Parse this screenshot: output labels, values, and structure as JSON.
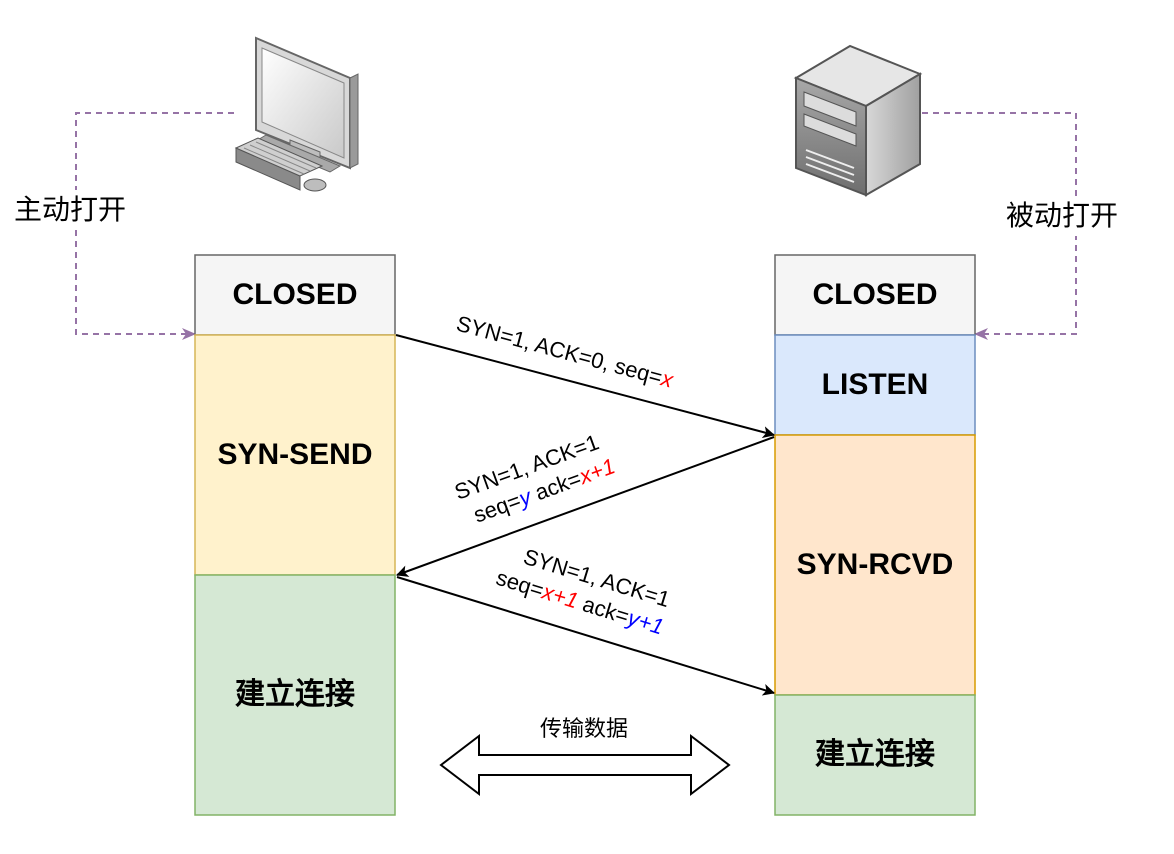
{
  "client": {
    "open_label": "主动打开",
    "states": [
      "CLOSED",
      "SYN-SEND",
      "建立连接"
    ]
  },
  "server": {
    "open_label": "被动打开",
    "states": [
      "CLOSED",
      "LISTEN",
      "SYN-RCVD",
      "建立连接"
    ]
  },
  "messages": {
    "m1": {
      "text": "SYN=1, ACK=0, seq=",
      "var": "x"
    },
    "m2": {
      "line1": "SYN=1, ACK=1",
      "seq_label": "seq=",
      "seq_var": "y",
      "ack_label": " ack=",
      "ack_var": "x+1"
    },
    "m3": {
      "line1": "SYN=1, ACK=1",
      "seq_label": "seq=",
      "seq_var": "x+1",
      "ack_label": " ack=",
      "ack_var": "y+1"
    }
  },
  "data_transfer_label": "传输数据",
  "colors": {
    "closed": "#f5f5f5",
    "syn_send": "#fff2cc",
    "established": "#d5e8d4",
    "listen": "#dae8fc",
    "syn_rcvd": "#ffe6cc",
    "dashed_line": "#9673a6",
    "highlight_red": "#ff0000",
    "highlight_blue": "#0000ff"
  }
}
